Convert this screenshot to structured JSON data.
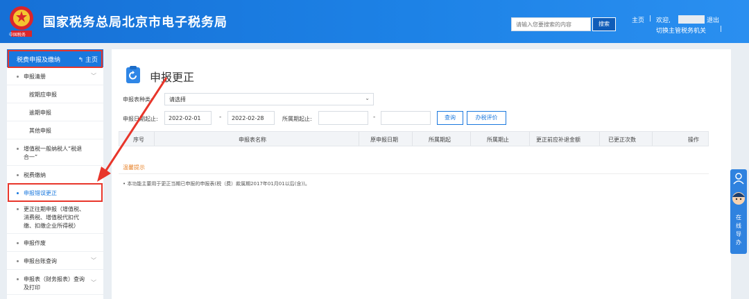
{
  "header": {
    "title": "国家税务总局北京市电子税务局",
    "emblem_caption": "中国税务",
    "search_placeholder": "请输入您要搜索的内容",
    "search_button": "搜索",
    "home_link": "主页",
    "welcome": "欢迎,",
    "logout": "退出",
    "switch_authority": "切换主管税务机关",
    "sep": "|"
  },
  "sidebar": {
    "header_label": "税费申报及缴纳",
    "home_label": "主页",
    "items": [
      {
        "label": "申报清册",
        "level": 1,
        "expandable": true
      },
      {
        "label": "按期应申报",
        "level": 2
      },
      {
        "label": "逾期申报",
        "level": 2
      },
      {
        "label": "其他申报",
        "level": 2
      },
      {
        "label": "增值税一般纳税人“税退合一”",
        "line1": "增值税一般纳税人“税退",
        "line2": "合一”",
        "level": 1
      },
      {
        "label": "税费缴纳",
        "level": 1
      },
      {
        "label": "申报错误更正",
        "level": 1,
        "active": true
      },
      {
        "label": "更正往期申报（增值税、消费税、增值税附征代扣代缴、扣缴企业所得税）",
        "line1": "更正往期申报（增值税、",
        "line2": "消费税、增值税代扣代",
        "line3": "缴、扣缴企业所得税）",
        "level": 1
      },
      {
        "label": "申报作废",
        "level": 1
      },
      {
        "label": "申报台账查询",
        "level": 1,
        "expandable": true
      },
      {
        "label": "申报表（财务报表）查询及打印",
        "line1": "申报表（财务报表）查询",
        "line2": "及打印",
        "level": 1,
        "expandable": true
      }
    ]
  },
  "main": {
    "page_title": "申报更正",
    "form": {
      "type_label": "申报表种类:",
      "type_value": "请选择",
      "date_label": "申报日期起止:",
      "date_from": "2022-02-01",
      "date_to": "2022-02-28",
      "period_label": "所属期起止:",
      "period_from": "",
      "period_to": "",
      "dash": "-",
      "query_button": "查询",
      "rate_button": "办税评价"
    },
    "table": {
      "columns": [
        "序号",
        "申报表名称",
        "原申报日期",
        "所属期起",
        "所属期止",
        "更正前应补退金额",
        "已更正次数",
        "操作"
      ],
      "rows": []
    },
    "tip_title": "温馨提示",
    "tip_text": "• 本功能主要用于更正当期已申报的申报表(税（费）款属期2017年01月01以后(含))。"
  },
  "float_widget": {
    "label": [
      "在",
      "线",
      "导",
      "办"
    ]
  },
  "colors": {
    "header_blue": "#1a78de",
    "highlight_red": "#e8352a",
    "tip_orange": "#e8832a"
  }
}
